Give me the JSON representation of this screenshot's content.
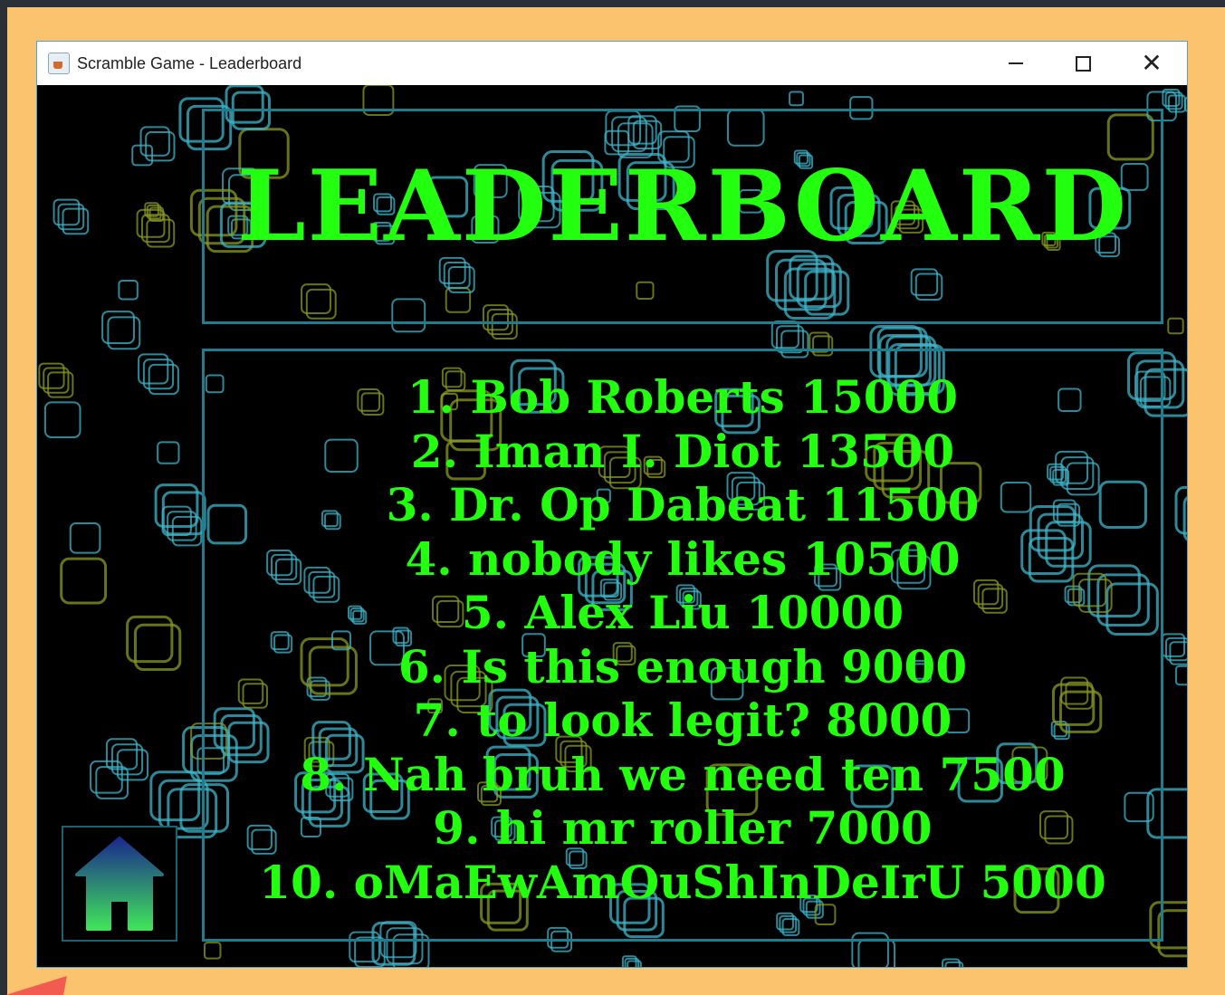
{
  "window": {
    "title": "Scramble Game - Leaderboard",
    "controls": [
      "minimize",
      "maximize",
      "close"
    ]
  },
  "leaderboard": {
    "heading": "LEADERBOARD",
    "entries": [
      "1. Bob Roberts 15000",
      "2. Iman I. Diot 13500",
      "3. Dr. Op Dabeat 11500",
      "4. nobody likes 10500",
      "5. Alex Liu 10000",
      "6. Is this enough 9000",
      "7. to look legit? 8000",
      "8. Nah bruh we need ten 7500",
      "9. hi mr roller 7000",
      "10. oMaEwAmOuShInDeIrU 5000"
    ]
  },
  "home_button": {
    "icon": "house-icon"
  },
  "colors": {
    "text": "#22ff0f",
    "frame": "#1f7e8e",
    "background": "#000000",
    "square_cyan": "#3fb6c9",
    "square_olive": "#8a9a22",
    "home_gradient_top": "#1a2a8c",
    "home_gradient_bottom": "#3fe35a",
    "page_background": "#fcc36e"
  }
}
